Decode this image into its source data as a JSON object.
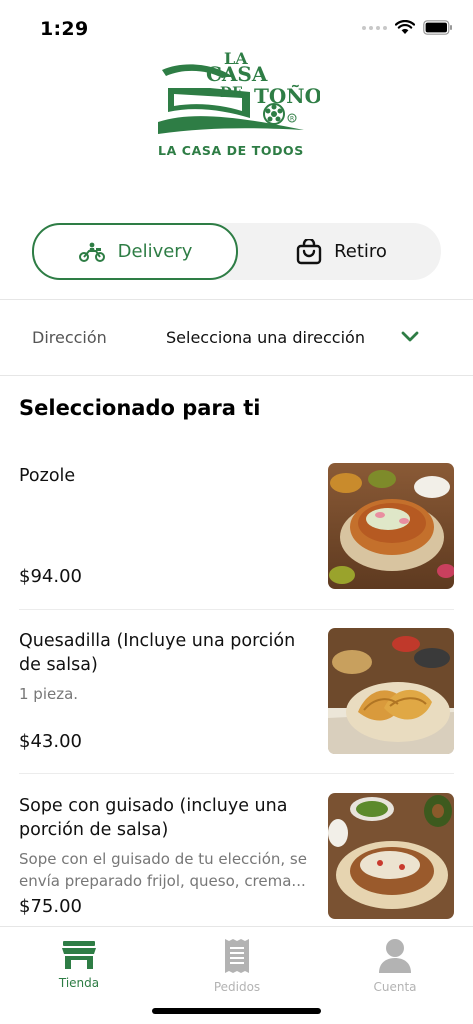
{
  "status": {
    "time": "1:29"
  },
  "brand": {
    "line1": "LA",
    "line2": "CASA",
    "line3": "DE",
    "line4": "TOÑO",
    "tagline": "LA CASA DE TODOS",
    "color": "#2e7d45"
  },
  "mode_toggle": {
    "delivery_label": "Delivery",
    "pickup_label": "Retiro",
    "selected": "Delivery",
    "delivery_icon": "motorcycle-icon",
    "pickup_icon": "shopping-bag-icon"
  },
  "address": {
    "label": "Dirección",
    "value": "Selecciona una dirección",
    "icon": "chevron-down-icon"
  },
  "section": {
    "title": "Seleccionado para ti"
  },
  "products": [
    {
      "name": "Pozole",
      "description": "",
      "price": "$94.00"
    },
    {
      "name": "Quesadilla (Incluye una porción de salsa)",
      "description": "1 pieza.",
      "price": "$43.00"
    },
    {
      "name": "Sope con guisado (incluye una porción de salsa)",
      "description": "Sope con el guisado de tu elección, se envía preparado frijol, queso, crema...",
      "price": "$75.00"
    }
  ],
  "tabs": [
    {
      "label": "Tienda",
      "icon": "store-icon",
      "active": true
    },
    {
      "label": "Pedidos",
      "icon": "receipt-icon",
      "active": false
    },
    {
      "label": "Cuenta",
      "icon": "account-icon",
      "active": false
    }
  ],
  "colors": {
    "accent": "#2e7d45",
    "inactive_tab": "#b3b3b3",
    "toggle_bg": "#f2f2f2"
  }
}
